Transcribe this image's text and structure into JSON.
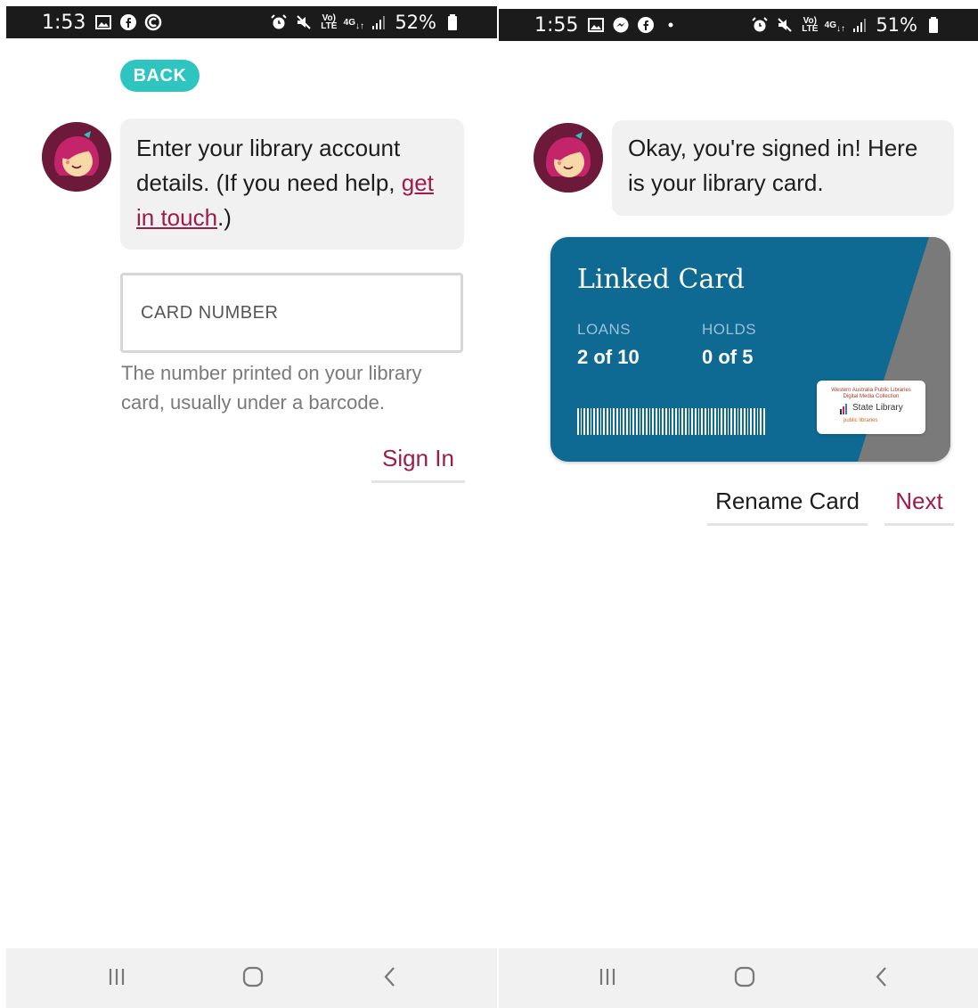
{
  "left": {
    "status": {
      "time": "1:53",
      "battery": "52%",
      "network": "4G",
      "volte": "VoLTE"
    },
    "back_label": "BACK",
    "message": {
      "text_before": "Enter your library account details. (If you need help, ",
      "link_text": "get in touch",
      "text_after": ".)"
    },
    "card_number_placeholder": "CARD NUMBER",
    "card_number_value": "",
    "hint": "The number printed on your library card, usually under a barcode.",
    "sign_in_label": "Sign In"
  },
  "right": {
    "status": {
      "time": "1:55",
      "battery": "51%",
      "network": "4G",
      "volte": "VoLTE"
    },
    "message": "Okay, you're signed in! Here is your library card.",
    "card": {
      "title": "Linked Card",
      "loans_label": "LOANS",
      "loans_value": "2 of 10",
      "holds_label": "HOLDS",
      "holds_value": "0 of 5",
      "logo_text_1": "Western Australia Public Libraries",
      "logo_text_2": "Digital Media Collection",
      "logo_name": "State Library",
      "logo_sub": "public libraries"
    },
    "rename_label": "Rename Card",
    "next_label": "Next"
  },
  "colors": {
    "accent": "#9c1c4c",
    "back_button": "#2ec4c0",
    "card_blue": "#0e6993",
    "card_stripe": "#7a7a7a",
    "bubble": "#f1f1f1",
    "avatar_bg": "#6d1a3a"
  },
  "icons": {
    "status_left_screen": [
      "image-icon",
      "facebook-icon",
      "c-app-icon"
    ],
    "status_right_screen": [
      "image-icon",
      "messenger-icon",
      "facebook-icon",
      "dot-icon"
    ],
    "status_common": [
      "alarm-icon",
      "mute-icon",
      "volte-icon",
      "4g-icon",
      "signal-icon",
      "battery-icon"
    ],
    "nav": [
      "recent-apps-icon",
      "home-icon",
      "back-icon"
    ]
  }
}
